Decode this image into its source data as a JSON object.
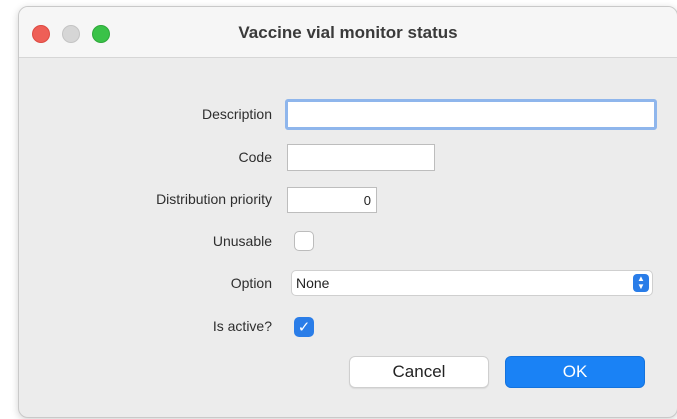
{
  "window": {
    "title": "Vaccine vial monitor status"
  },
  "form": {
    "description": {
      "label": "Description",
      "value": ""
    },
    "code": {
      "label": "Code",
      "value": ""
    },
    "distribution_priority": {
      "label": "Distribution priority",
      "value": "0"
    },
    "unusable": {
      "label": "Unusable",
      "checked": false
    },
    "option": {
      "label": "Option",
      "selected": "None"
    },
    "is_active": {
      "label": "Is active?",
      "checked": true
    }
  },
  "buttons": {
    "cancel": "Cancel",
    "ok": "OK"
  },
  "colors": {
    "accent": "#1a82f5",
    "close": "#ee5f57",
    "maximize": "#3ac248"
  }
}
